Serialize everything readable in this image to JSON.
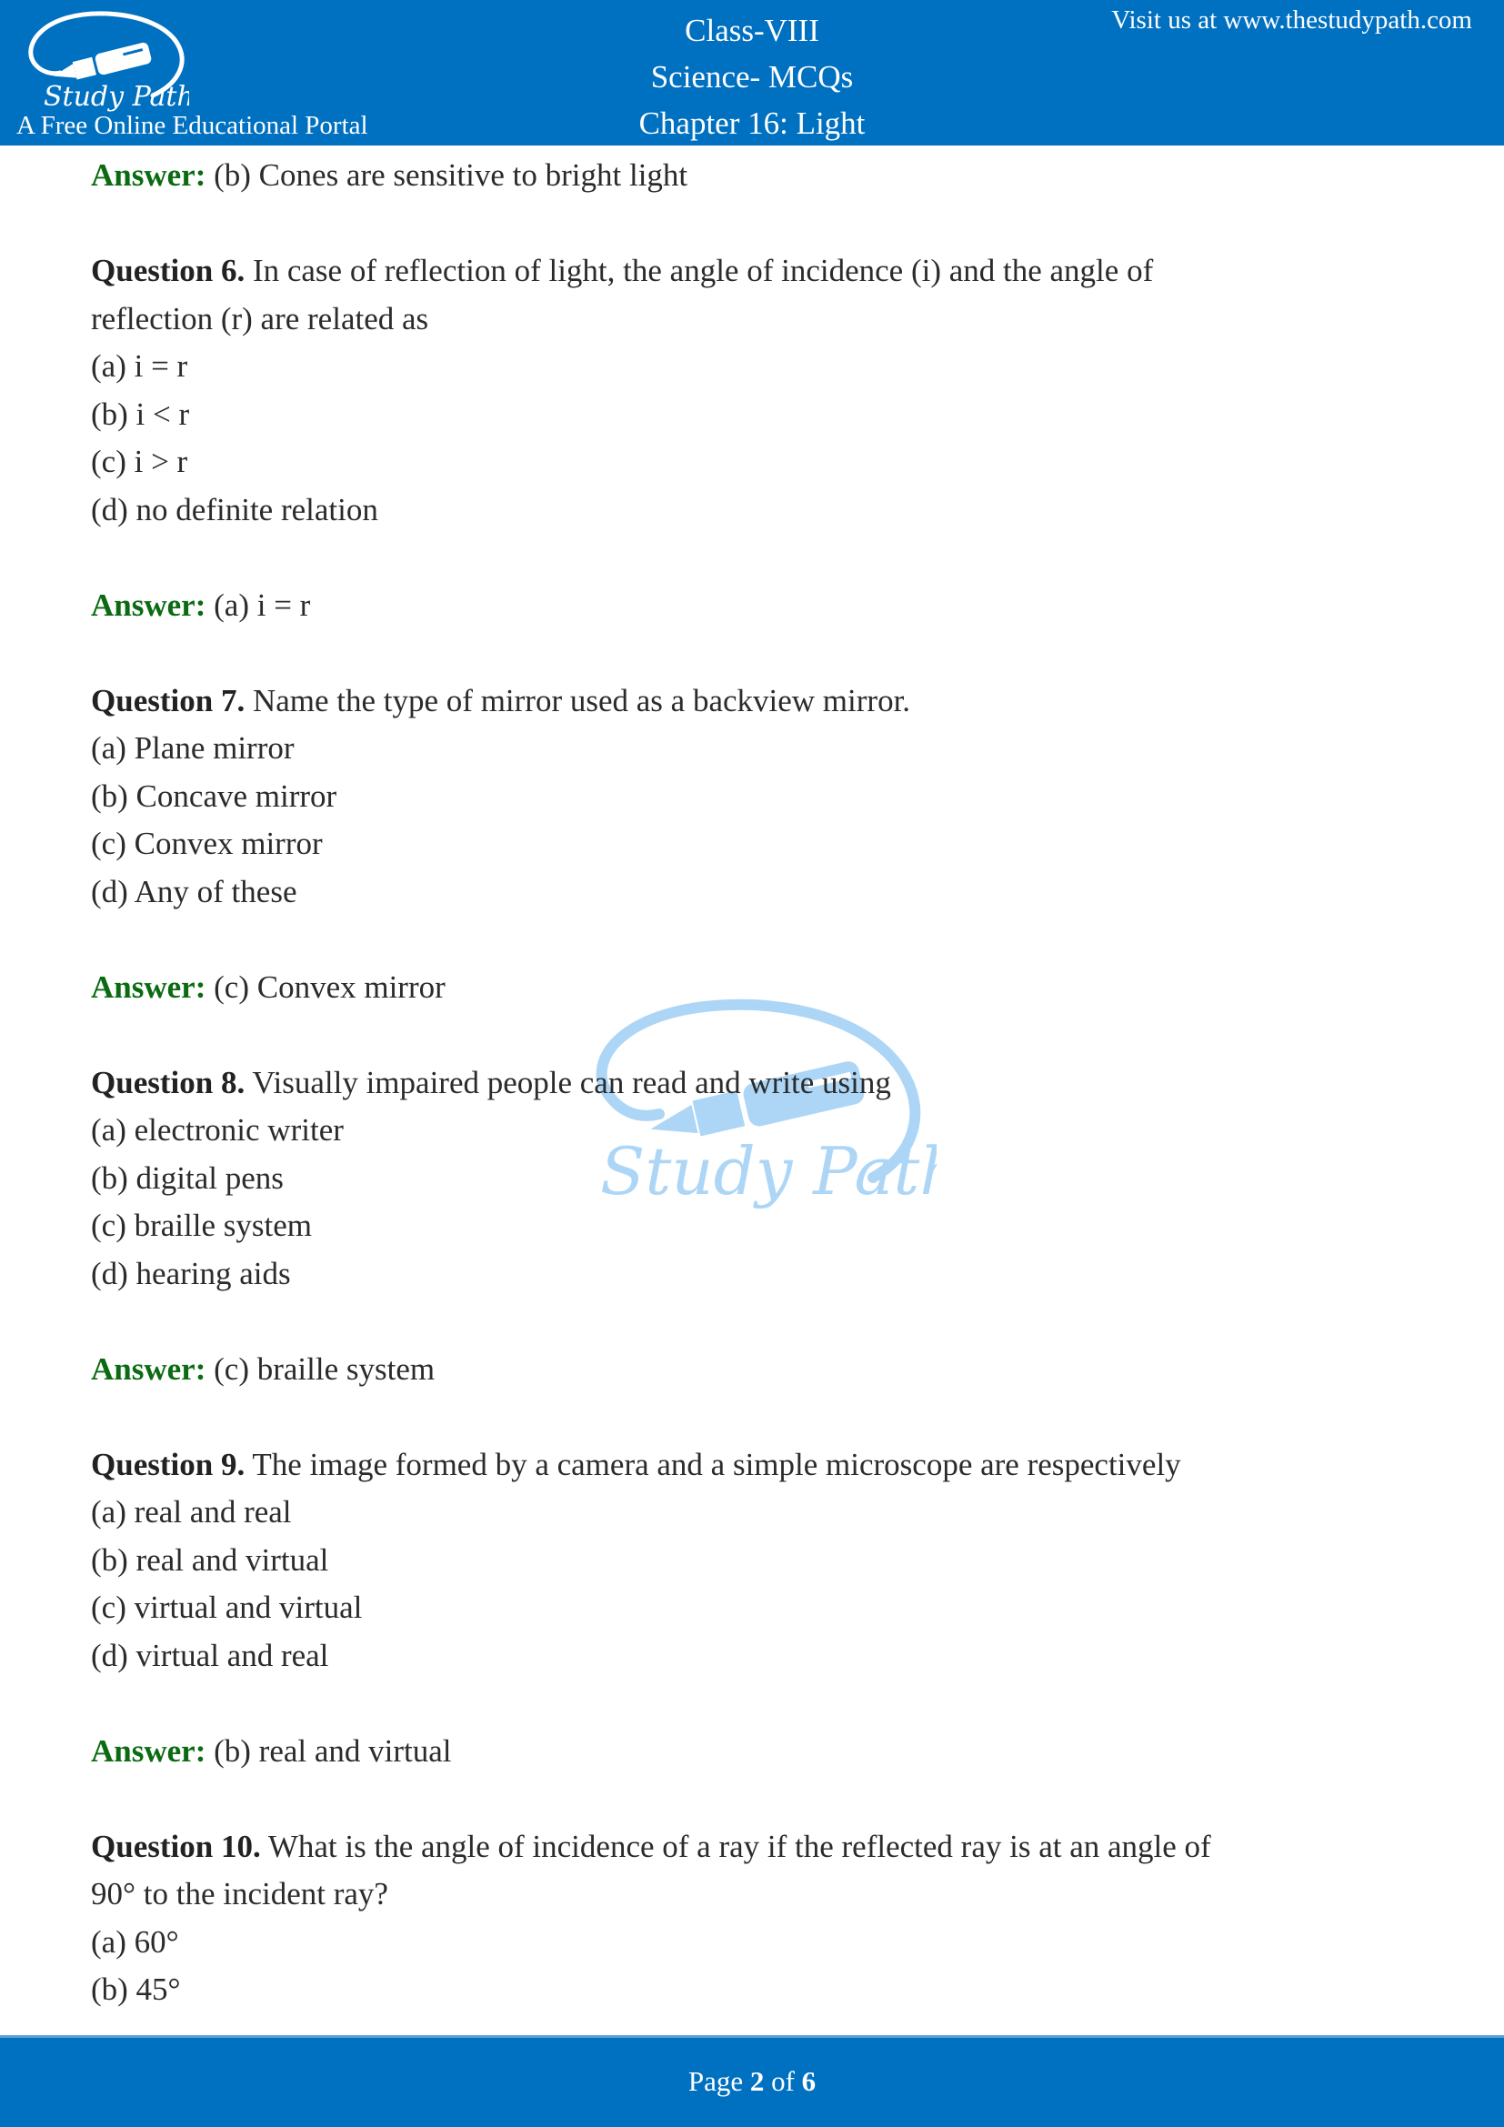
{
  "header": {
    "logo_text": "Study Path",
    "tagline": "A Free Online Educational Portal",
    "title_lines": [
      "Class-VIII",
      "Science- MCQs",
      "Chapter 16: Light"
    ],
    "visit_text": "Visit us at www.thestudypath.com",
    "background_color": "#0070c0"
  },
  "answer_label": "Answer:",
  "answer_color": "#0b6b12",
  "previous_answer": {
    "text": "(b) Cones are sensitive to bright light"
  },
  "questions": [
    {
      "label": "Question 6.",
      "text": "In case of reflection of light, the angle of incidence (i) and the angle of",
      "text_cont": "reflection (r) are related as",
      "options": [
        "(a) i = r",
        "(b) i < r",
        "(c) i > r",
        "(d) no definite relation"
      ],
      "answer": "(a) i = r"
    },
    {
      "label": "Question 7.",
      "text": "Name the type of mirror used as a backview mirror.",
      "options": [
        "(a) Plane mirror",
        "(b) Concave mirror",
        "(c) Convex mirror",
        "(d) Any of these"
      ],
      "answer": "(c) Convex mirror"
    },
    {
      "label": "Question 8.",
      "text": "Visually impaired people can read and write using",
      "options": [
        "(a) electronic writer",
        "(b) digital pens",
        "(c) braille system",
        "(d) hearing aids"
      ],
      "answer": "(c) braille system"
    },
    {
      "label": "Question 9.",
      "text": "The image formed by a camera and a simple microscope are respectively",
      "options": [
        "(a) real and real",
        "(b) real and virtual",
        "(c) virtual and virtual",
        "(d) virtual and real"
      ],
      "answer": "(b) real and virtual"
    },
    {
      "label": "Question 10.",
      "text": "What is the angle of incidence of a ray if the reflected ray is at an angle of",
      "text_cont": "90° to the incident ray?",
      "options": [
        "(a) 60°",
        "(b) 45°"
      ]
    }
  ],
  "watermark": {
    "text": "Study Path",
    "color": "#9fd0f5"
  },
  "footer": {
    "page_prefix": "Page",
    "current_page": "2",
    "of_text": "of",
    "total_pages": "6"
  }
}
